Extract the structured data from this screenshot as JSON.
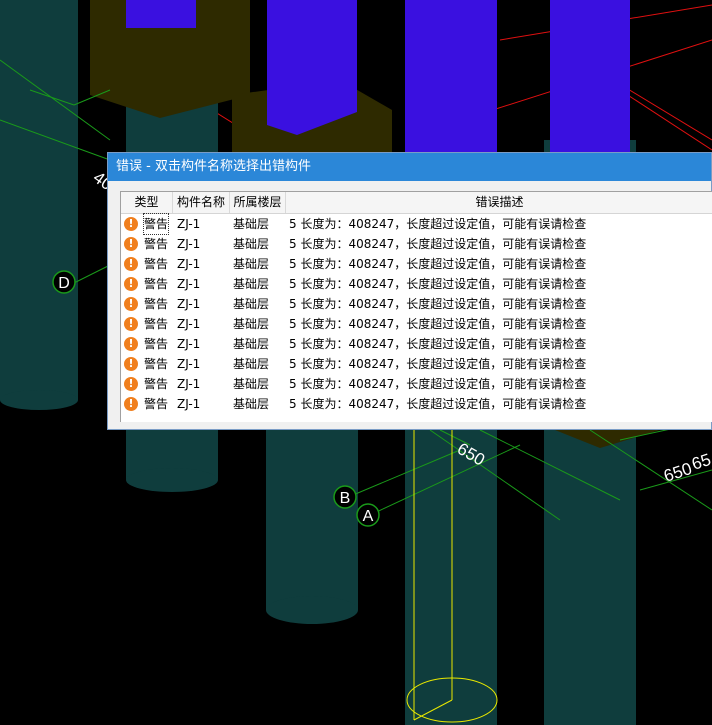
{
  "scene": {
    "axis_labels": [
      "D",
      "B",
      "A"
    ],
    "dim_labels": [
      "40",
      "650",
      "650",
      "65"
    ]
  },
  "dialog": {
    "title": "错误 - 双击构件名称选择出错构件",
    "columns": [
      "类型",
      "构件名称",
      "所属楼层",
      "错误描述"
    ],
    "rows": [
      {
        "icon": "warning-icon",
        "type": "警告",
        "name": "ZJ-1",
        "floor": "基础层",
        "desc": "5 长度为：408247，长度超过设定值，可能有误请检查"
      },
      {
        "icon": "warning-icon",
        "type": "警告",
        "name": "ZJ-1",
        "floor": "基础层",
        "desc": "5 长度为：408247，长度超过设定值，可能有误请检查"
      },
      {
        "icon": "warning-icon",
        "type": "警告",
        "name": "ZJ-1",
        "floor": "基础层",
        "desc": "5 长度为：408247，长度超过设定值，可能有误请检查"
      },
      {
        "icon": "warning-icon",
        "type": "警告",
        "name": "ZJ-1",
        "floor": "基础层",
        "desc": "5 长度为：408247，长度超过设定值，可能有误请检查"
      },
      {
        "icon": "warning-icon",
        "type": "警告",
        "name": "ZJ-1",
        "floor": "基础层",
        "desc": "5 长度为：408247，长度超过设定值，可能有误请检查"
      },
      {
        "icon": "warning-icon",
        "type": "警告",
        "name": "ZJ-1",
        "floor": "基础层",
        "desc": "5 长度为：408247，长度超过设定值，可能有误请检查"
      },
      {
        "icon": "warning-icon",
        "type": "警告",
        "name": "ZJ-1",
        "floor": "基础层",
        "desc": "5 长度为：408247，长度超过设定值，可能有误请检查"
      },
      {
        "icon": "warning-icon",
        "type": "警告",
        "name": "ZJ-1",
        "floor": "基础层",
        "desc": "5 长度为：408247，长度超过设定值，可能有误请检查"
      },
      {
        "icon": "warning-icon",
        "type": "警告",
        "name": "ZJ-1",
        "floor": "基础层",
        "desc": "5 长度为：408247，长度超过设定值，可能有误请检查"
      },
      {
        "icon": "warning-icon",
        "type": "警告",
        "name": "ZJ-1",
        "floor": "基础层",
        "desc": "5 长度为：408247，长度超过设定值，可能有误请检查"
      }
    ]
  },
  "colors": {
    "pile": "#0f3d3d",
    "cap": "#2e2a00",
    "column": "#3a10e0",
    "grid_line": "#1a9a1a",
    "red_line": "#e01010",
    "highlight": "#e8e800",
    "titlebar": "#2b87d8",
    "warning": "#f07f1e"
  }
}
